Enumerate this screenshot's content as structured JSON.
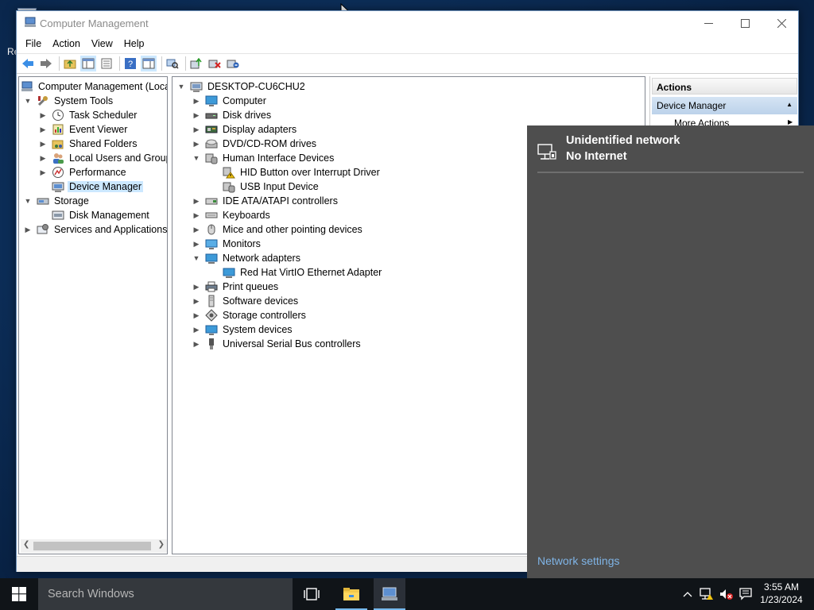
{
  "window": {
    "title": "Computer Management",
    "controls": {
      "minimize": "—",
      "maximize": "☐",
      "close": "✕"
    }
  },
  "menu": [
    "File",
    "Action",
    "View",
    "Help"
  ],
  "toolbar": {
    "buttons": [
      "back-icon",
      "forward-icon",
      "up-folder-icon",
      "show-hide-tree-icon",
      "properties-icon",
      "help-icon",
      "show-action-pane-icon",
      "scan-hardware-icon",
      "update-driver-icon",
      "uninstall-device-icon",
      "disable-device-icon"
    ]
  },
  "left_tree": {
    "root": "Computer Management (Local",
    "system_tools": "System Tools",
    "task_scheduler": "Task Scheduler",
    "event_viewer": "Event Viewer",
    "shared_folders": "Shared Folders",
    "local_users": "Local Users and Groups",
    "performance": "Performance",
    "device_manager": "Device Manager",
    "storage": "Storage",
    "disk_management": "Disk Management",
    "services": "Services and Applications"
  },
  "devices": {
    "host": "DESKTOP-CU6CHU2",
    "computer": "Computer",
    "disk_drives": "Disk drives",
    "display_adapters": "Display adapters",
    "dvd": "DVD/CD-ROM drives",
    "hid": "Human Interface Devices",
    "hid_button": "HID Button over Interrupt Driver",
    "usb_input": "USB Input Device",
    "ide": "IDE ATA/ATAPI controllers",
    "keyboards": "Keyboards",
    "mice": "Mice and other pointing devices",
    "monitors": "Monitors",
    "network_adapters": "Network adapters",
    "virtio": "Red Hat VirtIO Ethernet Adapter",
    "print_queues": "Print queues",
    "software_devices": "Software devices",
    "storage_controllers": "Storage controllers",
    "system_devices": "System devices",
    "usb_controllers": "Universal Serial Bus controllers"
  },
  "actions": {
    "header": "Actions",
    "section": "Device Manager",
    "more": "More Actions"
  },
  "network_flyout": {
    "name": "Unidentified network",
    "status": "No Internet",
    "settings_link": "Network settings"
  },
  "taskbar": {
    "search_placeholder": "Search Windows",
    "time": "3:55 AM",
    "date": "1/23/2024"
  },
  "desktop": {
    "fragment_text": "Re"
  },
  "colors": {
    "selection": "#cce8ff",
    "flyout_bg": "#4e4e4e",
    "link": "#7fb4e6",
    "taskbar": "#101418",
    "search_box": "#34383d"
  }
}
